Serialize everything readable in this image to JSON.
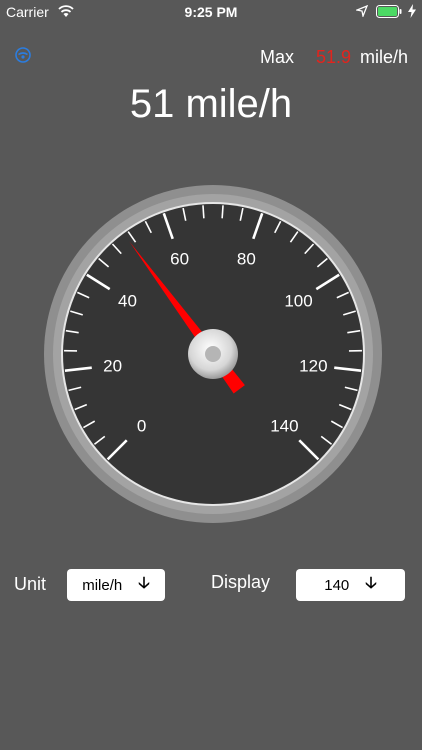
{
  "status_bar": {
    "carrier": "Carrier",
    "time": "9:25 PM",
    "battery_color": "#4cd964"
  },
  "header": {
    "max_label": "Max",
    "max_value": "51.9",
    "max_unit": "mile/h",
    "max_color": "#e2241d"
  },
  "readout": {
    "speed_text": "51 mile/h"
  },
  "gauge": {
    "labels": [
      "0",
      "20",
      "40",
      "60",
      "80",
      "100",
      "120",
      "140"
    ],
    "current_speed": 51,
    "min": 0,
    "max": 140,
    "needle_color": "#ff0000"
  },
  "controls": {
    "unit_label": "Unit",
    "unit_value": "mile/h",
    "display_label": "Display",
    "display_value": "140",
    "arrow_icon": "arrow-down-icon"
  }
}
